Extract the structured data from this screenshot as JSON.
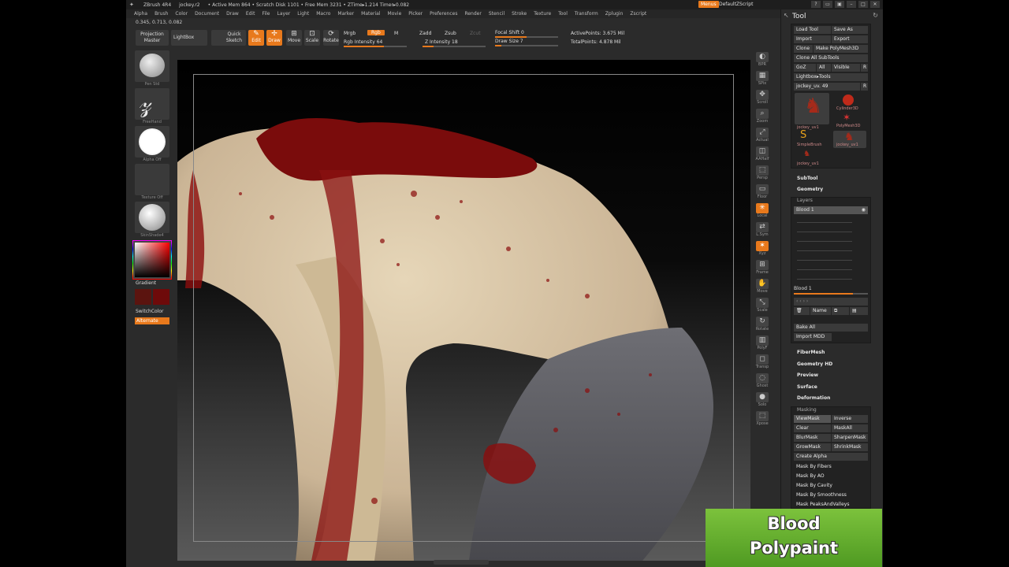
{
  "app": {
    "name": "ZBrush 4R4",
    "file": "jockey.r2",
    "stats": "• Active Mem 864 • Scratch Disk 1101 • Free Mem 3231 • ZTime▸1.214 Timer▸0.082",
    "menus_button": "Menus",
    "script": "DefaultZScript"
  },
  "menubar": [
    "Alpha",
    "Brush",
    "Color",
    "Document",
    "Draw",
    "Edit",
    "File",
    "Layer",
    "Light",
    "Macro",
    "Marker",
    "Material",
    "Movie",
    "Picker",
    "Preferences",
    "Render",
    "Stencil",
    "Stroke",
    "Texture",
    "Tool",
    "Transform",
    "Zplugin",
    "Zscript"
  ],
  "coords": "0.345, 0.713, 0.082",
  "toolbar": {
    "projection_master": "Projection Master",
    "lightbox": "LightBox",
    "quick_sketch": "Quick Sketch",
    "edit": "Edit",
    "draw": "Draw",
    "move": "Move",
    "scale": "Scale",
    "rotate": "Rotate",
    "mrgb": "Mrgb",
    "rgb": "Rgb",
    "m": "M",
    "zadd": "Zadd",
    "zsub": "Zsub",
    "zcut": "Zcut",
    "rgb_intensity": "Rgb Intensity 64",
    "z_intensity": "Z Intensity 18",
    "focal_shift": "Focal Shift 0",
    "draw_size": "Draw Size 7",
    "active_points": "ActivePoints: 3.675 Mil",
    "total_points": "TotalPoints: 4.878 Mil"
  },
  "leftshelf": {
    "brush_label": "Pen Std",
    "stroke_label": "FreeHand",
    "alpha_label": "Alpha Off",
    "texture_label": "Texture Off",
    "material_label": "SkinShade4",
    "gradient": "Gradient",
    "switchcolor": "SwitchColor",
    "alternate": "Alternate"
  },
  "rightcol": [
    "BPR",
    "SPix",
    "Scroll",
    "Zoom",
    "Actual",
    "AAHalf",
    "Persp",
    "Floor",
    "Local",
    "L.Sym",
    "Xyz",
    "Frame",
    "Move",
    "Scale",
    "Rotate",
    "PolyF",
    "Transp",
    "Ghost",
    "Solo",
    "Xpose"
  ],
  "toolpanel": {
    "title": "Tool",
    "load_tool": "Load Tool",
    "save_as": "Save As",
    "import": "Import",
    "export": "Export",
    "clone": "Clone",
    "make_polymesh": "Make PolyMesh3D",
    "clone_all": "Clone All SubTools",
    "goz": "GoZ",
    "all": "All",
    "visible": "Visible",
    "r": "R",
    "lightbox_tools": "Lightbox▸Tools",
    "current_tool": "jockey_uv. 49",
    "tools": [
      "jockey_uv1",
      "Cylinder3D",
      "PolyMesh3D",
      "SimpleBrush",
      "jockey_uv1",
      "jockey_uv1"
    ],
    "subtool": "SubTool",
    "geometry": "Geometry",
    "layers": "Layers",
    "layer_name": "Blood 1",
    "layer_slider": "Blood 1",
    "name_btn": "Name",
    "bake_all": "Bake All",
    "import_mdd": "Import MDD",
    "sections": [
      "FiberMesh",
      "Geometry HD",
      "Preview",
      "Surface",
      "Deformation"
    ],
    "masking": "Masking",
    "mask_buttons": [
      "ViewMask",
      "Inverse",
      "Clear",
      "MaskAll",
      "BlurMask",
      "SharpenMask",
      "GrowMask",
      "ShrinkMask"
    ],
    "create_alpha": "Create Alpha",
    "mask_by": [
      "Mask By Fibers",
      "Mask By AO",
      "Mask By Cavity",
      "Mask By Smoothness",
      "Mask PeaksAndValleys"
    ]
  },
  "banner": {
    "line1": "Blood",
    "line2": "Polypaint"
  },
  "colors": {
    "accent": "#e8791c",
    "banner_green": "#6ab22f",
    "blood": "#8b0d0d",
    "skin": "#d8c6a8"
  }
}
